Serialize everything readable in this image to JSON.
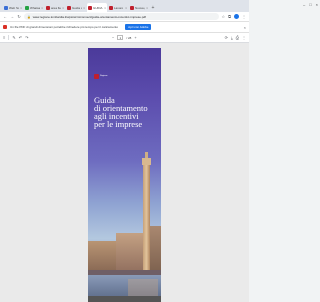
{
  "browser": {
    "tabs": [
      {
        "title": "Web Scuola - Lo",
        "color": "#3b6fd6",
        "active": false
      },
      {
        "title": "Whatsap",
        "color": "#25a244",
        "active": false
      },
      {
        "title": "area flessione dig",
        "color": "#c0202d",
        "active": false
      },
      {
        "title": "Guida orientame",
        "color": "#c0202d",
        "active": false
      },
      {
        "title": "GUIDA ORIENTAM",
        "color": "#c0202d",
        "active": true
      },
      {
        "title": "Lavoro e pensione",
        "color": "#c0202d",
        "active": false
      },
      {
        "title": "Nuova guida incen",
        "color": "#c0202d",
        "active": false
      }
    ],
    "new_tab": "+",
    "window_controls": {
      "minimize": "–",
      "maximize": "□",
      "close": "×"
    },
    "nav": {
      "back": "←",
      "forward": "→",
      "reload": "↻"
    },
    "url": "www.regione.lombardia.it/wps/wcm/connect/guida-orientamento-incentivi-imprese.pdf",
    "lock_icon": "🔒"
  },
  "infobar": {
    "message": "Un file PDF di grandi dimensioni potrebbe richiedere più tempo per il caricamento",
    "button_label": "Apri con Adobe",
    "close": "×"
  },
  "pdf_toolbar": {
    "menu": "≡",
    "page_current": "1",
    "page_total": "/ 28",
    "zoom": "100%",
    "zoom_out": "−",
    "zoom_in": "+"
  },
  "pdf": {
    "logo_text": "Regione",
    "title_lines": [
      "Guida",
      "di orientamento",
      "agli incentivi",
      "per le imprese"
    ]
  }
}
